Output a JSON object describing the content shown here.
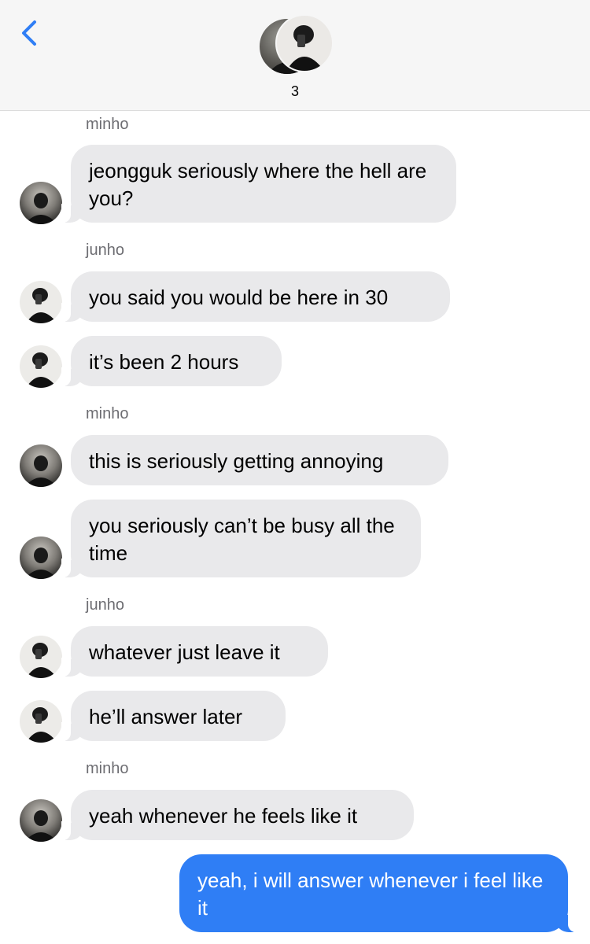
{
  "header": {
    "member_count": "3",
    "back_icon": "chevron-left-icon"
  },
  "colors": {
    "incoming_bubble": "#e9e9eb",
    "outgoing_bubble": "#2f7ef5",
    "accent": "#2f7ef5",
    "sender_label": "#6d6d72"
  },
  "messages": [
    {
      "sender": "minho",
      "text": "jeongguk seriously where the hell are you?"
    },
    {
      "sender": "junho",
      "text": "you said you would be here in 30"
    },
    {
      "sender": "junho",
      "text": "it’s been 2 hours"
    },
    {
      "sender": "minho",
      "text": "this is seriously getting annoying"
    },
    {
      "sender": "minho",
      "text": "you seriously can’t be busy all the time"
    },
    {
      "sender": "junho",
      "text": "whatever just leave it"
    },
    {
      "sender": "junho",
      "text": "he’ll answer later"
    },
    {
      "sender": "minho",
      "text": "yeah whenever he feels like it"
    },
    {
      "sender": "me",
      "text": "yeah, i will answer whenever i feel like it"
    }
  ],
  "sender_labels": [
    "minho",
    "junho",
    "minho",
    "junho",
    "minho"
  ]
}
